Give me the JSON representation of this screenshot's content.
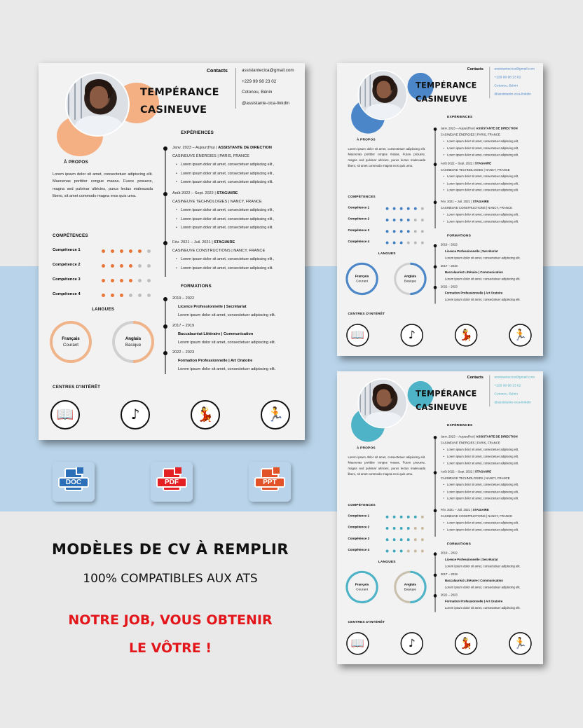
{
  "promo": {
    "title": "MODÈLES DE CV À REMPLIR",
    "subtitle": "100% COMPATIBLES AUX ATS",
    "slogan_line1": "NOTRE JOB, VOUS OBTENIR",
    "slogan_line2": "LE VÔTRE !",
    "formats": [
      {
        "label": "DOC",
        "color": "#2d70b8",
        "icon": "doc-file-icon"
      },
      {
        "label": "PDF",
        "color": "#e32124",
        "icon": "pdf-file-icon"
      },
      {
        "label": "PPT",
        "color": "#e2532a",
        "icon": "ppt-file-icon"
      }
    ]
  },
  "cv": {
    "name_line1": "TEMPÉRANCE",
    "name_line2": "CASINEUVE",
    "contacts_heading": "Contacts",
    "contacts": [
      "assistantecica@gmail.com",
      "+229 99 98 23 02",
      "Cotonou, Bénin",
      "@assistante-cica-linkdin"
    ],
    "about_heading": "À PROPOS",
    "about_text": "Lorem ipsum dolor sit amet, consectetuer adipiscing elit. Maecenas porttitor congue massa. Fusce posuere, magna sed pulvinar ultricies, purus lectus malesuada libero, sit amet commodo magna eros quis urna.",
    "skills_heading": "COMPÉTENCES",
    "skills": [
      {
        "label": "Compétence 1",
        "level": 5
      },
      {
        "label": "Compétence 2",
        "level": 4
      },
      {
        "label": "Compétence 3",
        "level": 4
      },
      {
        "label": "Compétence 4",
        "level": 3
      }
    ],
    "skill_dots_total": 6,
    "languages_heading": "LANGUES",
    "languages": [
      {
        "name": "Français",
        "level": "Courant",
        "fill": 1.0
      },
      {
        "name": "Anglais",
        "level": "Basique",
        "fill": 0.5
      }
    ],
    "interests_heading": "CENTRES D'INTÉRÊT",
    "interests": [
      {
        "icon": "book-icon",
        "glyph": "📖"
      },
      {
        "icon": "music-note-icon",
        "glyph": "♪"
      },
      {
        "icon": "dancer-icon",
        "glyph": "💃"
      },
      {
        "icon": "runner-icon",
        "glyph": "🏃"
      }
    ],
    "experiences_heading": "EXPÉRIENCES",
    "experiences": [
      {
        "date": "Janv. 2023 – Aujourd'hui",
        "title": "ASSISTANTE DE DIRECTION",
        "company": "CASINEUVE ÉNERGIES  |  PARIS, FRANCE",
        "bullets": [
          "Lorem ipsum dolor sit amet, consectetuer adipiscing elit ,",
          "Lorem ipsum dolor sit amet, consectetuer adipiscing elit ,",
          "Lorem ipsum dolor sit amet, consectetuer adipiscing elit."
        ]
      },
      {
        "date": "Août 2022 – Sept. 2022",
        "title": "STAGIAIRE",
        "company": "CASINEUVE TECHNOLOGIES  |  NANCY, FRANCE",
        "bullets": [
          "Lorem ipsum dolor sit amet, consectetuer adipiscing elit ,",
          "Lorem ipsum dolor sit amet, consectetuer adipiscing elit ,",
          "Lorem ipsum dolor sit amet, consectetuer adipiscing elit."
        ]
      },
      {
        "date": "Fév. 2021 – Juil. 2021",
        "title": "STAGIAIRE",
        "company": "CASINEUVE CONSTRUCTIONS  |  NANCY, FRANCE",
        "bullets": [
          "Lorem ipsum dolor sit amet, consectetuer adipiscing elit ,",
          "Lorem ipsum dolor sit amet, consectetuer adipiscing elit."
        ]
      }
    ],
    "education_heading": "FORMATIONS",
    "education": [
      {
        "date": "2019 – 2022",
        "title": "Licence Professionnelle  |  Secrétariat",
        "desc": "Lorem ipsum dolor sit amet, consectetuer adipiscing elit."
      },
      {
        "date": "2017 – 2019",
        "title": "Baccalauréat Littéraire  |  Communication",
        "desc": "Lorem ipsum dolor sit amet, consectetuer adipiscing elit."
      },
      {
        "date": "2022 – 2023",
        "title": "Formation Professionnelle  |  Art Oratoire",
        "desc": "Lorem ipsum dolor sit amet, consectetuer adipiscing elit."
      }
    ]
  },
  "themes": {
    "orange": {
      "accent": "#f4b083",
      "dot_on": "#e8763a",
      "dot_off": "#bfbfbf",
      "ring_fill": "#f0b48a",
      "ring_rest": "#d0d0d0",
      "contact_color": "#222"
    },
    "blue": {
      "accent": "#4a86c8",
      "dot_on": "#3f7fc4",
      "dot_off": "#b8b8b8",
      "ring_fill": "#4a86c8",
      "ring_rest": "#cfcfcf",
      "contact_color": "#4a86c8"
    },
    "teal": {
      "accent": "#4fb3c7",
      "dot_on": "#3aa8bd",
      "dot_off": "#c9b79c",
      "ring_fill": "#4fb3c7",
      "ring_rest": "#c9c0ad",
      "contact_color": "#4fb3c7"
    }
  }
}
